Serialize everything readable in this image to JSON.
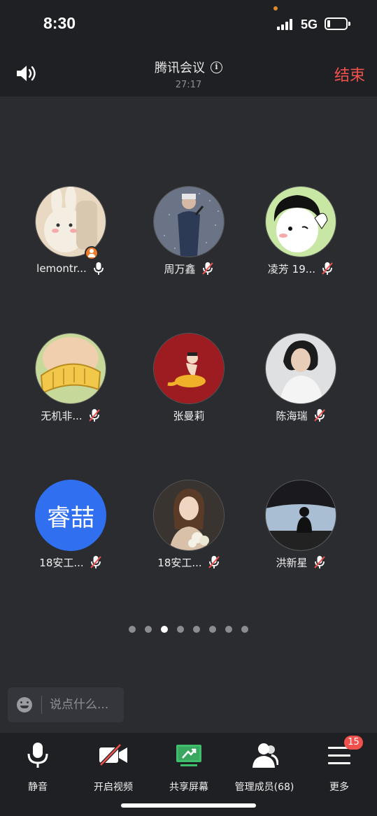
{
  "status_bar": {
    "time": "8:30",
    "network": "5G"
  },
  "header": {
    "title": "腾讯会议",
    "timer": "27:17",
    "end_label": "结束"
  },
  "participants": [
    {
      "name": "lemontr...",
      "avatar": "bunny-avatar",
      "mic": "on",
      "host": true
    },
    {
      "name": "周万鑫",
      "avatar": "singer-photo",
      "mic": "muted"
    },
    {
      "name": "凌芳 19...",
      "avatar": "girl-cartoon",
      "mic": "muted"
    },
    {
      "name": "无机非...",
      "avatar": "corn-avatar",
      "mic": "muted"
    },
    {
      "name": "张曼莉",
      "avatar": "red-cartoon",
      "mic": "none"
    },
    {
      "name": "陈海瑞",
      "avatar": "woman-photo",
      "mic": "muted"
    },
    {
      "name": "18安工...",
      "avatar_text": "睿喆",
      "mic": "muted"
    },
    {
      "name": "18安工...",
      "avatar": "girl-photo",
      "mic": "muted"
    },
    {
      "name": "洪新星",
      "avatar": "silhouette-photo",
      "mic": "muted"
    }
  ],
  "pagination": {
    "total": 8,
    "current": 3
  },
  "chat": {
    "placeholder": "说点什么..."
  },
  "toolbar": {
    "mute": "静音",
    "video": "开启视频",
    "share": "共享屏幕",
    "members": "管理成员(68)",
    "more": "更多",
    "more_badge": "15"
  },
  "colors": {
    "accent": "#2f6ff0",
    "end_red": "#f0514c",
    "share_green": "#3fbf6b",
    "background": "#2b2c30",
    "bar": "#1f2023"
  }
}
